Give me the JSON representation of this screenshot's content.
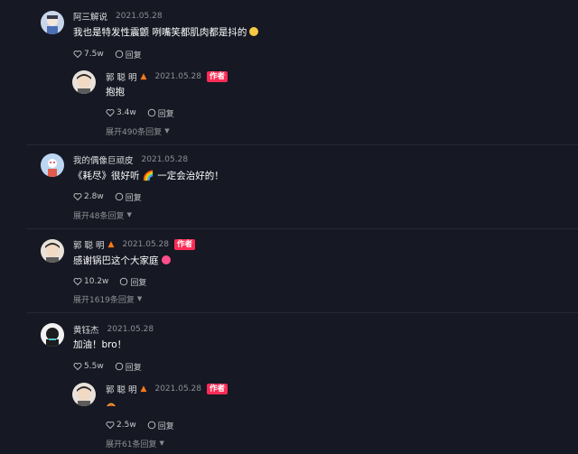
{
  "comments": [
    {
      "username": "阿三解说",
      "date": "2021.05.28",
      "text": "我也是特发性震颤 咧嘴笑都肌肉都是抖的",
      "likes": "7.5w",
      "reply_label": "回复",
      "replies": [
        {
          "username": "郭 聪 明",
          "date": "2021.05.28",
          "badge": "作者",
          "text": "抱抱",
          "likes": "3.4w",
          "reply_label": "回复",
          "expand_label": "展开490条回复"
        }
      ]
    },
    {
      "username": "我的偶像巨顽皮",
      "date": "2021.05.28",
      "text": "《耗尽》很好听 🌈 一定会治好的！",
      "likes": "2.8w",
      "reply_label": "回复",
      "expand_label": "展开48条回复"
    },
    {
      "username": "郭 聪 明",
      "date": "2021.05.28",
      "badge": "作者",
      "text": "感谢锅巴这个大家庭",
      "likes": "10.2w",
      "reply_label": "回复",
      "expand_label": "展开1619条回复"
    },
    {
      "username": "黄钰杰",
      "date": "2021.05.28",
      "text": "加油！bro！",
      "likes": "5.5w",
      "reply_label": "回复",
      "replies": [
        {
          "username": "郭 聪 明",
          "date": "2021.05.28",
          "badge": "作者",
          "text": "",
          "likes": "2.5w",
          "reply_label": "回复",
          "expand_label": "展开61条回复"
        }
      ]
    }
  ],
  "icons": {
    "like": "heart-outline-icon",
    "reply": "speech-bubble-icon",
    "author_flame": "flame-icon"
  },
  "colors": {
    "background": "#161823",
    "author_badge": "#fe2c55",
    "secondary_text": "rgba(255,255,255,0.5)"
  }
}
